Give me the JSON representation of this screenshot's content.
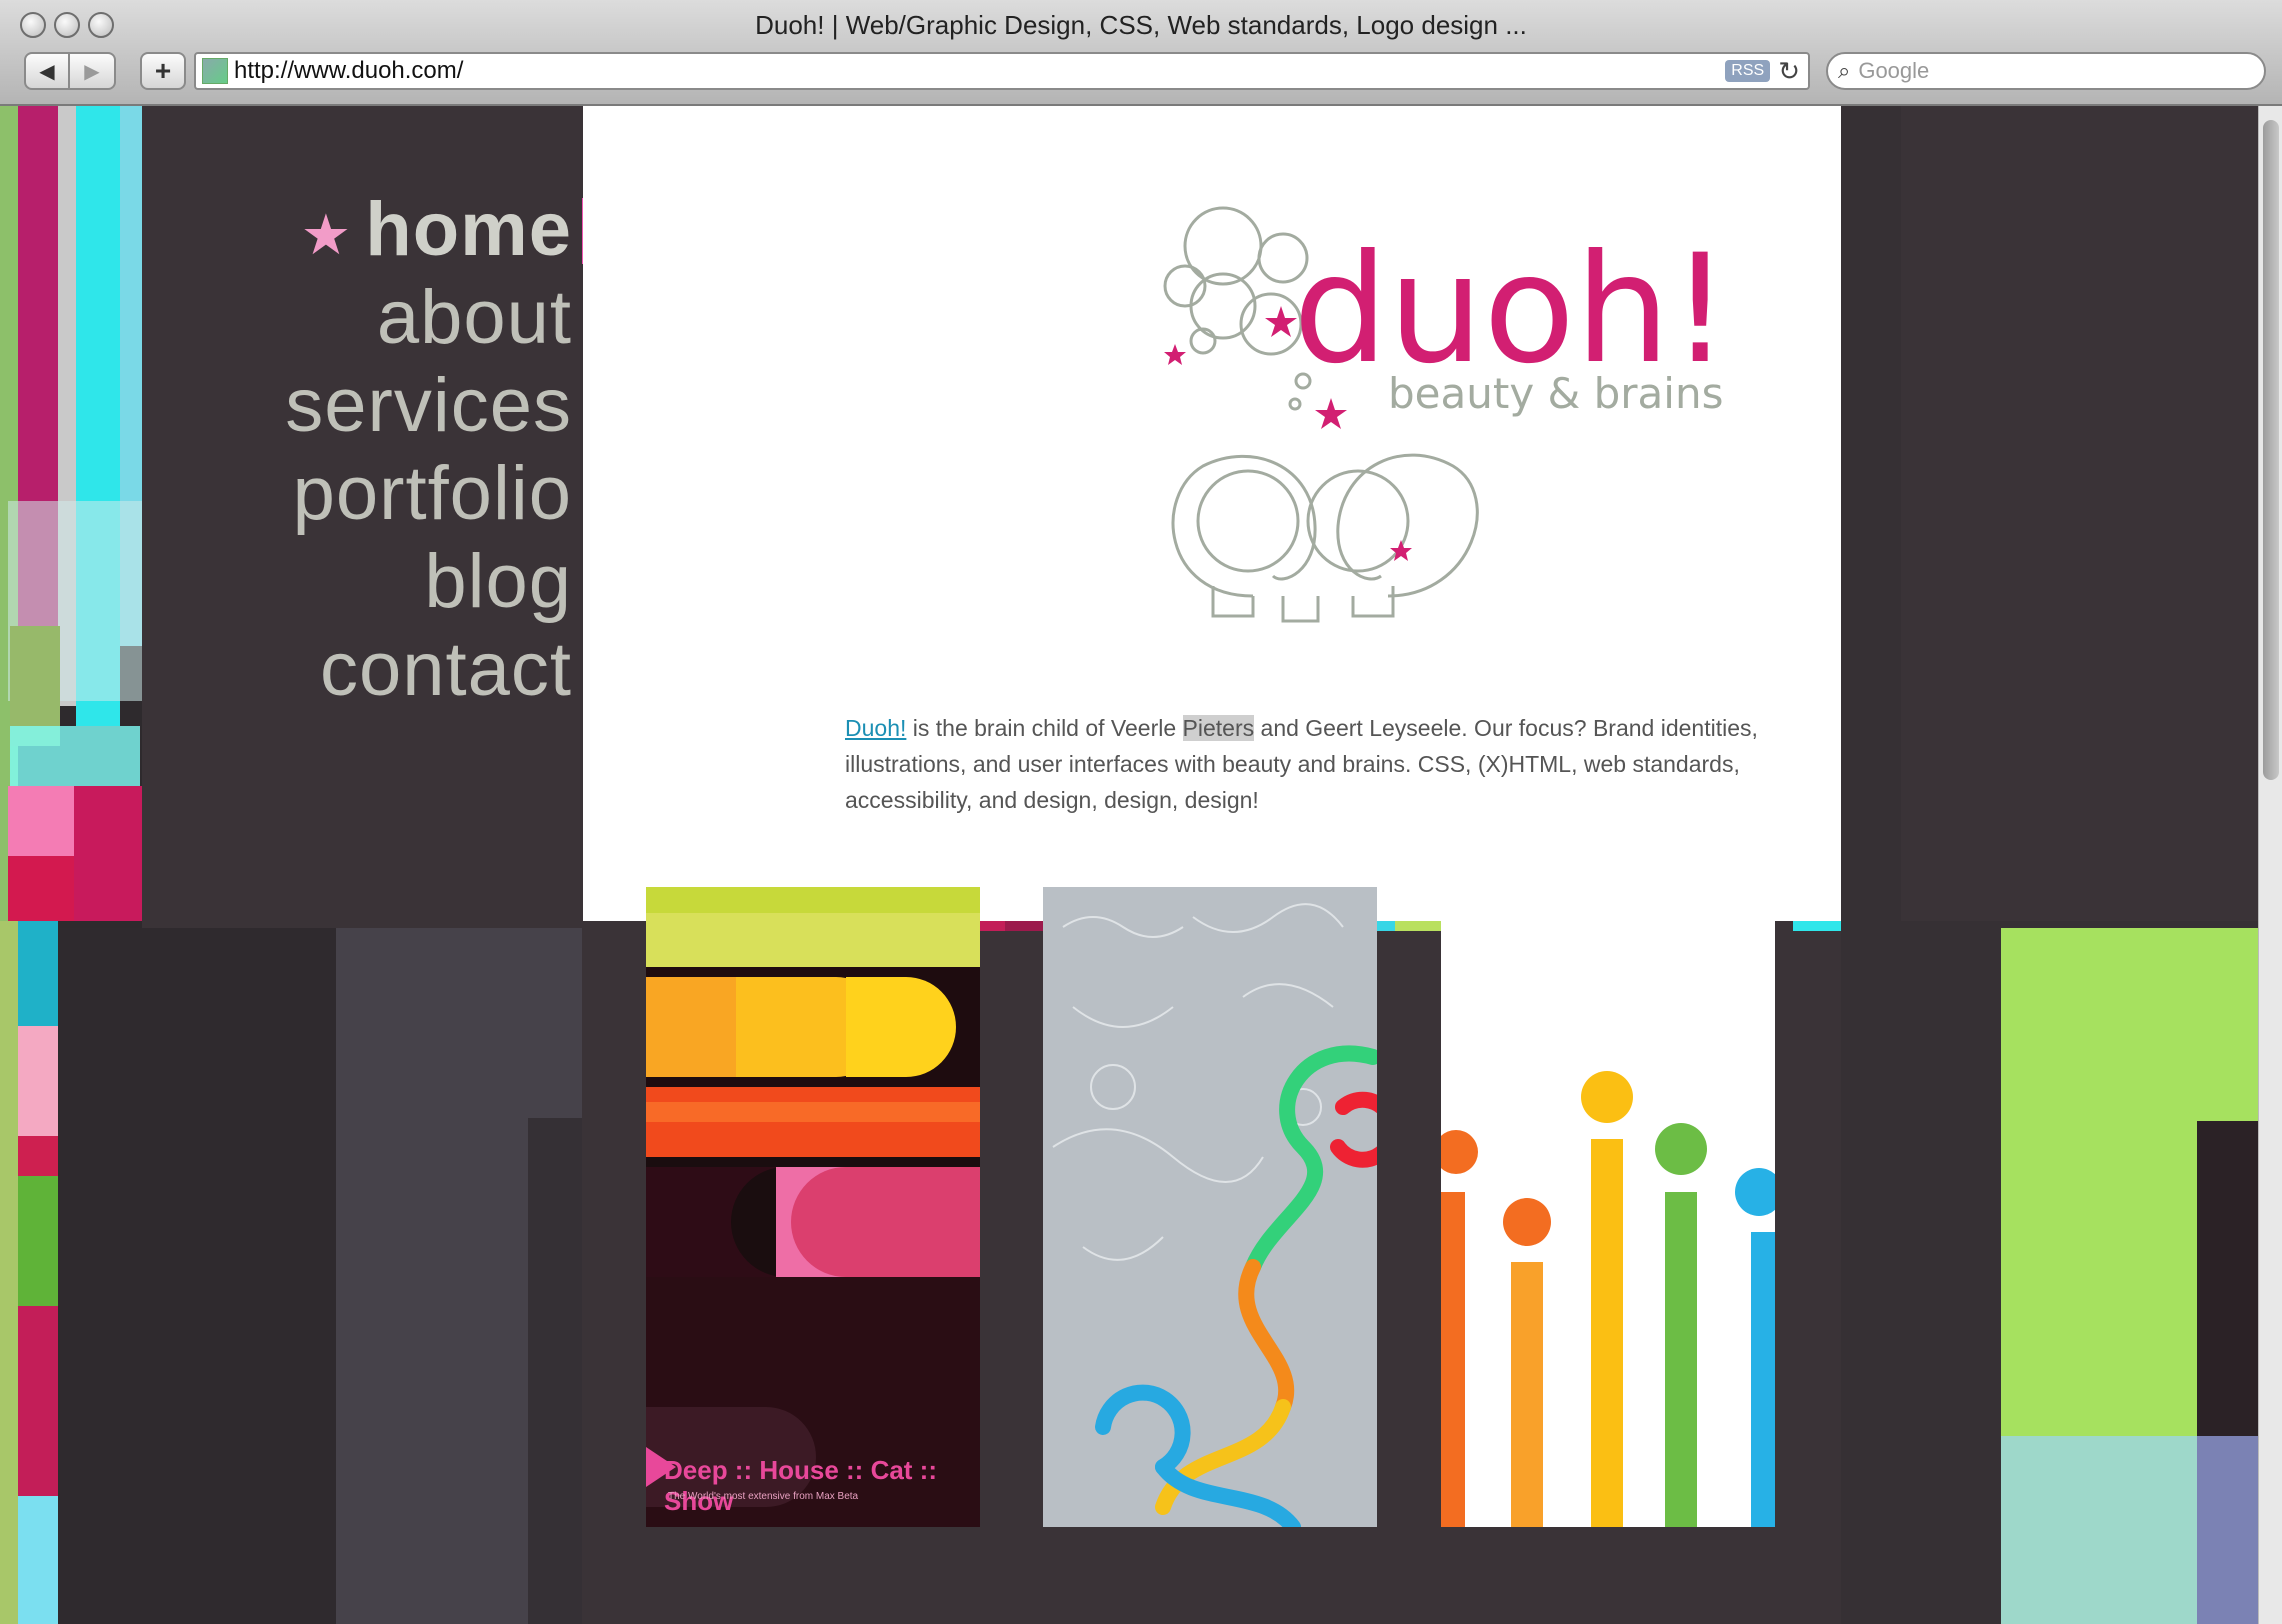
{
  "window": {
    "title": "Duoh! | Web/Graphic Design, CSS, Web standards, Logo design ..."
  },
  "toolbar": {
    "back_label": "◀",
    "forward_label": "▶",
    "add_label": "+",
    "url": "http://www.duoh.com/",
    "rss_label": "RSS",
    "reload_label": "C",
    "search_placeholder": "Google"
  },
  "nav": {
    "items": [
      {
        "label": "home",
        "active": true
      },
      {
        "label": "about"
      },
      {
        "label": "services"
      },
      {
        "label": "portfolio"
      },
      {
        "label": "blog"
      },
      {
        "label": "contact"
      }
    ]
  },
  "logo": {
    "name": "duoh!",
    "tagline": "beauty & brains"
  },
  "intro": {
    "link": "Duoh!",
    "text1": " is the brain child of Veerle ",
    "highlight": "Pieters",
    "text2": " and Geert Leyseele. Our focus? Brand identities, illustrations, and user interfaces with beauty and brains. CSS, (X)HTML, web standards, accessibility, and design, design, design!"
  },
  "portfolio": {
    "card1_title": "Deep :: House :: Cat :: Show",
    "card1_sub": "The World's most extensive from Max Beta"
  },
  "colors": {
    "accent_pink": "#d21f72",
    "logo_gray": "#a3aba0",
    "nav_bg": "#3a3337"
  }
}
